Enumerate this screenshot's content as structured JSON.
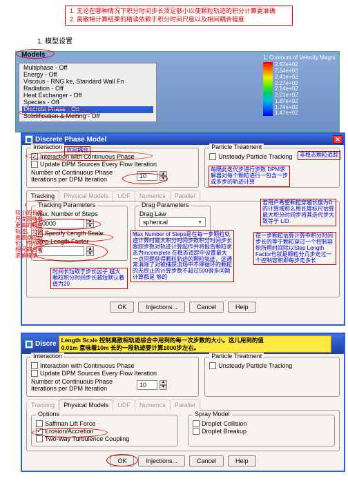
{
  "top_notes": {
    "l1": "1. 无论在哪种情况下积分时间步长须足够小以使颗粒轨迹的积分计算更准确",
    "l2": "2. 离散相计算结果的精读依赖于积分时间尺度以及相间耦合程度"
  },
  "section_title": "1. 模型设置",
  "models": {
    "title": "Models",
    "items": [
      "Multiphase - Off",
      "Energy - Off",
      "Viscous - RNG ke, Standard Wall Fn",
      "Radiation - Off",
      "Heat Exchanger - Off",
      "Species - Off",
      "Discrete Phase - On",
      "Solidification & Melting - Off"
    ],
    "legend_title": "1: Contours of Velocity Magni",
    "legend_vals": [
      "2.67e+02",
      "2.54e+02",
      "2.41e+02",
      "2.27e+02",
      "2.14e+02",
      "2.01e+02",
      "1.87e+02",
      "1.74e+02",
      "1.47e+02"
    ]
  },
  "dpm1": {
    "title": "Discrete Phase Model",
    "interaction": {
      "legend": "Interaction",
      "ic": "Interaction with Continuous Phase",
      "ud": "Update DPM Sources Every Flow Iteration",
      "nci_label": "Number of Continuous Phase Iterations per DPM Iteration",
      "nci_val": "10"
    },
    "ptreat": {
      "legend": "Particle Treatment",
      "unst": "Unsteady Particle Tracking"
    },
    "tabs": [
      "Tracking",
      "Physical Models",
      "UDF",
      "Numerics",
      "Parallel"
    ],
    "tp_legend": "Tracking Parameters",
    "max_label": "Max. Number of Steps",
    "max_val": "50000",
    "sls": "Specify Length Scale",
    "slf_label": "Step Length Factor",
    "slf_val": "5",
    "dp_legend": "Drag Parameters",
    "drag_label": "Drag Law",
    "drag_val": "spherical",
    "buttons": [
      "OK",
      "Injections...",
      "Cancel",
      "Help"
    ],
    "annos": {
      "double": "双向耦合",
      "track": "非稳态颗粒追踪",
      "every": "每隔此迭代步进行步数 DPM求解器对每个颗粒进行一包含一步或多步的轨迹计算",
      "userD": "若用户希望颗粒穿越长度为D的计算域那么用长度标尺估算最大积分时间步将其迭代步大致等于 L/D",
      "maxN": "Max Number of Steps是在每一步颗粒轨迹计算时最大积分时间步数积分时间步长跟踪步数对轨迹计算起作并将报告颗粒状态为incomplete 在稳态追踪中设置最大一点问题获得颗粒轨迹的颗粒轨迹，这通常消除了对被捕获流场中不停循环的颗粒的无终止的计算步数不超过500很多问题计算都是 够的",
      "slfactor": "在一步颗粒估算计算中积分时间步长的等于颗粒穿过一个控制容积所用时间除以Step Length Factor也就是颗粒分几步走过一个控制容积即每步走多长",
      "interval": "时间长短取于步长因子 越大颗粒积分时间步长越短默认着值为20"
    }
  },
  "leftnote": "较小的长度尺度意味着更高的颗粒轨迹，分段离散点的估价，传热和相间耦合和求解精读",
  "dpm2": {
    "title": "Discre",
    "ybox_l1": "Length Scale 控制离散相轨迹综合中用到的每一次步数的大小。这儿用到的值",
    "ybox_l2": "0.01m 意味着10m 长的一段轨迹要计算1000步左右。",
    "interaction": {
      "legend": "Interaction",
      "ic": "Interaction with Continuous Phase",
      "ud": "Update DPM Sources Every Flow Iteration",
      "nci_label": "Number of Continuous Phase Iterations per DPM Iteration",
      "nci_val": "10"
    },
    "ptreat": {
      "legend": "Particle Treatment",
      "unst": "Unsteady Particle Tracking"
    },
    "tabs": [
      "Tracking",
      "Physical Models",
      "UDF",
      "Numerics",
      "Parallel"
    ],
    "options_legend": "Options",
    "opt1": "Saffman Lift Force",
    "opt2": "Erosion/Accretion",
    "opt3": "Two-Way Turbulence Coupling",
    "spray_legend": "Spray Model",
    "spray1": "Droplet Collision",
    "spray2": "Droplet Breakup",
    "buttons": [
      "OK",
      "Injections...",
      "Cancel",
      "Help"
    ]
  }
}
